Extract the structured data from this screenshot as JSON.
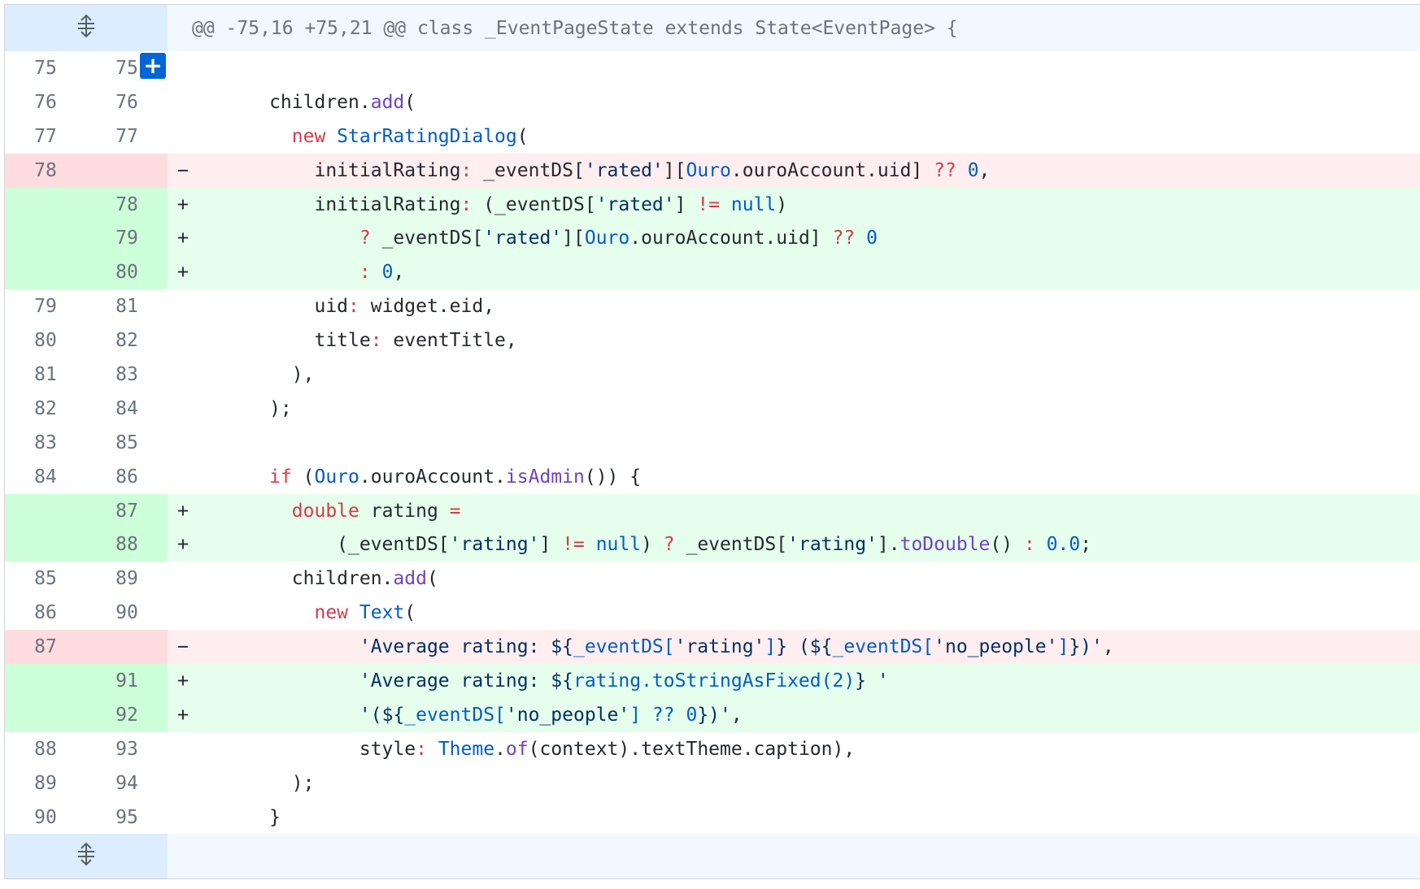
{
  "hunk_header": "@@ -75,16 +75,21 @@ class _EventPageState extends State<EventPage> {",
  "expand_icon": "unfold-icon",
  "add_comment_label": "+",
  "rows": [
    {
      "type": "ctx",
      "old": "75",
      "new": "75",
      "tokens": []
    },
    {
      "type": "ctx",
      "old": "76",
      "new": "76",
      "tokens": [
        [
          "",
          "      children."
        ],
        [
          "fn",
          "add"
        ],
        [
          "",
          "("
        ]
      ]
    },
    {
      "type": "ctx",
      "old": "77",
      "new": "77",
      "tokens": [
        [
          "",
          "        "
        ],
        [
          "kw",
          "new"
        ],
        [
          "cls",
          " StarRatingDialog"
        ],
        [
          "",
          "("
        ]
      ]
    },
    {
      "type": "del",
      "old": "78",
      "new": "",
      "tokens": [
        [
          "",
          "          initialRating"
        ],
        [
          "kw",
          ":"
        ],
        [
          "",
          " _eventDS["
        ],
        [
          "str",
          "'rated'"
        ],
        [
          "",
          "]["
        ],
        [
          "cls",
          "Ouro"
        ],
        [
          "",
          ".ouroAccount.uid] "
        ],
        [
          "kw",
          "??"
        ],
        [
          "",
          " "
        ],
        [
          "num-lit",
          "0"
        ],
        [
          "",
          ","
        ]
      ]
    },
    {
      "type": "add",
      "old": "",
      "new": "78",
      "tokens": [
        [
          "",
          "          initialRating"
        ],
        [
          "kw",
          ":"
        ],
        [
          "",
          " (_eventDS["
        ],
        [
          "str",
          "'rated'"
        ],
        [
          "",
          "] "
        ],
        [
          "kw",
          "!="
        ],
        [
          "",
          " "
        ],
        [
          "num-lit",
          "null"
        ],
        [
          "",
          ")"
        ]
      ]
    },
    {
      "type": "add",
      "old": "",
      "new": "79",
      "tokens": [
        [
          "",
          "              "
        ],
        [
          "kw",
          "?"
        ],
        [
          "",
          " _eventDS["
        ],
        [
          "str",
          "'rated'"
        ],
        [
          "",
          "]["
        ],
        [
          "cls",
          "Ouro"
        ],
        [
          "",
          ".ouroAccount.uid] "
        ],
        [
          "kw",
          "??"
        ],
        [
          "",
          " "
        ],
        [
          "num-lit",
          "0"
        ]
      ]
    },
    {
      "type": "add",
      "old": "",
      "new": "80",
      "tokens": [
        [
          "",
          "              "
        ],
        [
          "kw",
          ":"
        ],
        [
          "",
          " "
        ],
        [
          "num-lit",
          "0"
        ],
        [
          "",
          ","
        ]
      ]
    },
    {
      "type": "ctx",
      "old": "79",
      "new": "81",
      "tokens": [
        [
          "",
          "          uid"
        ],
        [
          "kw",
          ":"
        ],
        [
          "",
          " widget.eid,"
        ]
      ]
    },
    {
      "type": "ctx",
      "old": "80",
      "new": "82",
      "tokens": [
        [
          "",
          "          title"
        ],
        [
          "kw",
          ":"
        ],
        [
          "",
          " eventTitle,"
        ]
      ]
    },
    {
      "type": "ctx",
      "old": "81",
      "new": "83",
      "tokens": [
        [
          "",
          "        ),"
        ]
      ]
    },
    {
      "type": "ctx",
      "old": "82",
      "new": "84",
      "tokens": [
        [
          "",
          "      );"
        ]
      ]
    },
    {
      "type": "ctx",
      "old": "83",
      "new": "85",
      "tokens": []
    },
    {
      "type": "ctx",
      "old": "84",
      "new": "86",
      "tokens": [
        [
          "",
          "      "
        ],
        [
          "kw",
          "if"
        ],
        [
          "",
          " ("
        ],
        [
          "cls",
          "Ouro"
        ],
        [
          "",
          ".ouroAccount."
        ],
        [
          "fn",
          "isAdmin"
        ],
        [
          "",
          "()) {"
        ]
      ]
    },
    {
      "type": "add",
      "old": "",
      "new": "87",
      "tokens": [
        [
          "",
          "        "
        ],
        [
          "kw",
          "double"
        ],
        [
          "",
          " rating "
        ],
        [
          "kw",
          "="
        ]
      ]
    },
    {
      "type": "add",
      "old": "",
      "new": "88",
      "tokens": [
        [
          "",
          "            (_eventDS["
        ],
        [
          "str",
          "'rating'"
        ],
        [
          "",
          "] "
        ],
        [
          "kw",
          "!="
        ],
        [
          "",
          " "
        ],
        [
          "num-lit",
          "null"
        ],
        [
          "",
          ") "
        ],
        [
          "kw",
          "?"
        ],
        [
          "",
          " _eventDS["
        ],
        [
          "str",
          "'rating'"
        ],
        [
          "",
          "]."
        ],
        [
          "fn",
          "toDouble"
        ],
        [
          "",
          "() "
        ],
        [
          "kw",
          ":"
        ],
        [
          "",
          " "
        ],
        [
          "num-lit",
          "0.0"
        ],
        [
          "",
          ";"
        ]
      ]
    },
    {
      "type": "ctx",
      "old": "85",
      "new": "89",
      "tokens": [
        [
          "",
          "        children."
        ],
        [
          "fn",
          "add"
        ],
        [
          "",
          "("
        ]
      ]
    },
    {
      "type": "ctx",
      "old": "86",
      "new": "90",
      "tokens": [
        [
          "",
          "          "
        ],
        [
          "kw",
          "new"
        ],
        [
          "cls",
          " Text"
        ],
        [
          "",
          "("
        ]
      ]
    },
    {
      "type": "del",
      "old": "87",
      "new": "",
      "tokens": [
        [
          "",
          "              "
        ],
        [
          "str",
          "'Average rating: ${"
        ],
        [
          "cls",
          "_eventDS["
        ],
        [
          "str",
          "'rating'"
        ],
        [
          "cls",
          "]"
        ],
        [
          "str",
          "} (${"
        ],
        [
          "cls",
          "_eventDS["
        ],
        [
          "str",
          "'no_people'"
        ],
        [
          "cls",
          "]"
        ],
        [
          "str",
          "})'"
        ],
        [
          "",
          ","
        ]
      ]
    },
    {
      "type": "add",
      "old": "",
      "new": "91",
      "tokens": [
        [
          "",
          "              "
        ],
        [
          "str",
          "'Average rating: ${"
        ],
        [
          "cls",
          "rating.toStringAsFixed(2)"
        ],
        [
          "str",
          "} '"
        ]
      ]
    },
    {
      "type": "add",
      "old": "",
      "new": "92",
      "tokens": [
        [
          "",
          "              "
        ],
        [
          "str",
          "'(${"
        ],
        [
          "cls",
          "_eventDS["
        ],
        [
          "str",
          "'no_people'"
        ],
        [
          "cls",
          "] ?? 0"
        ],
        [
          "str",
          "})'"
        ],
        [
          "",
          ","
        ]
      ]
    },
    {
      "type": "ctx",
      "old": "88",
      "new": "93",
      "tokens": [
        [
          "",
          "              style"
        ],
        [
          "kw",
          ":"
        ],
        [
          "cls",
          " Theme"
        ],
        [
          "",
          "."
        ],
        [
          "fn",
          "of"
        ],
        [
          "",
          "(context).textTheme.caption),"
        ]
      ]
    },
    {
      "type": "ctx",
      "old": "89",
      "new": "94",
      "tokens": [
        [
          "",
          "        );"
        ]
      ]
    },
    {
      "type": "ctx",
      "old": "90",
      "new": "95",
      "tokens": [
        [
          "",
          "      }"
        ]
      ]
    }
  ]
}
